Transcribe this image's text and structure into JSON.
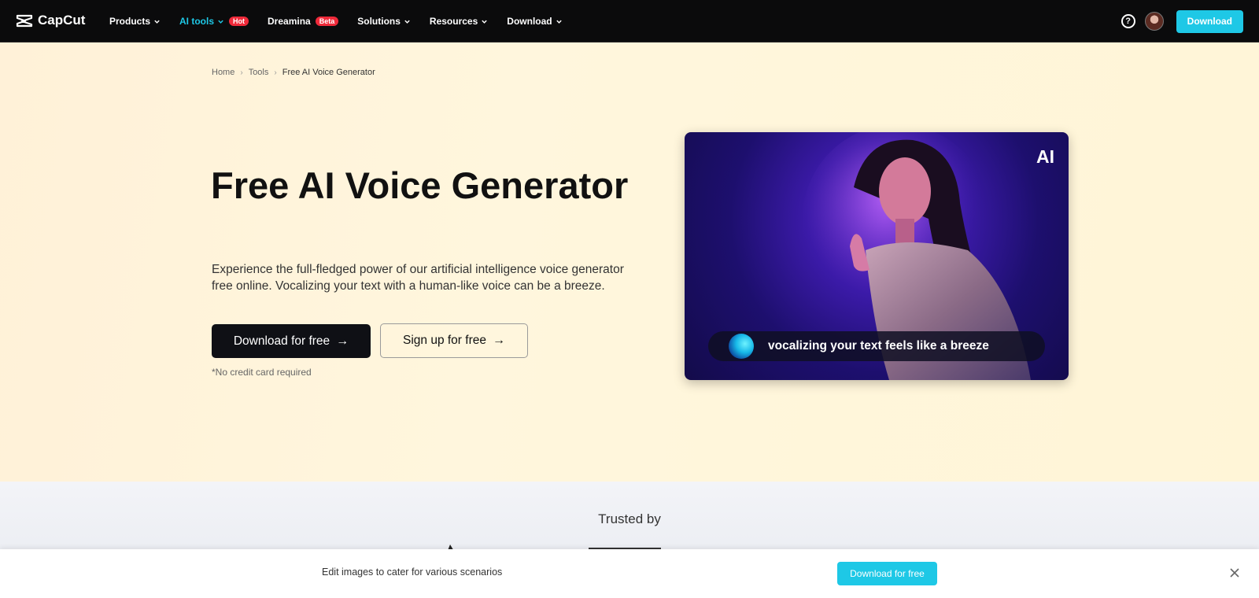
{
  "nav": {
    "brand": "CapCut",
    "items": [
      {
        "label": "Products",
        "active": false
      },
      {
        "label": "AI tools",
        "active": true,
        "badge": "Hot"
      },
      {
        "label": "Dreamina",
        "active": false,
        "badge": "Beta"
      },
      {
        "label": "Solutions",
        "active": false
      },
      {
        "label": "Resources",
        "active": false
      },
      {
        "label": "Download",
        "active": false
      }
    ],
    "download_label": "Download"
  },
  "breadcrumb": {
    "items": [
      "Home",
      "Tools",
      "Free AI Voice Generator"
    ]
  },
  "hero": {
    "title": "Free AI Voice Generator",
    "description": "Experience the full-fledged power of our artificial intelligence voice generator free online. Vocalizing your text with a human-like voice can be a breeze.",
    "primary_button": "Download for free",
    "secondary_button": "Sign up for free",
    "note": "*No credit card required",
    "media": {
      "badge": "AI",
      "caption": "vocalizing your text feels like a breeze"
    }
  },
  "trusted": {
    "title": "Trusted by"
  },
  "bottom_bar": {
    "text": "Edit images to cater for various scenarios",
    "cta": "Download for free"
  },
  "colors": {
    "accent": "#1ec8e6",
    "nav_bg": "#0b0b0c",
    "badge_red": "#ef2a3a"
  }
}
